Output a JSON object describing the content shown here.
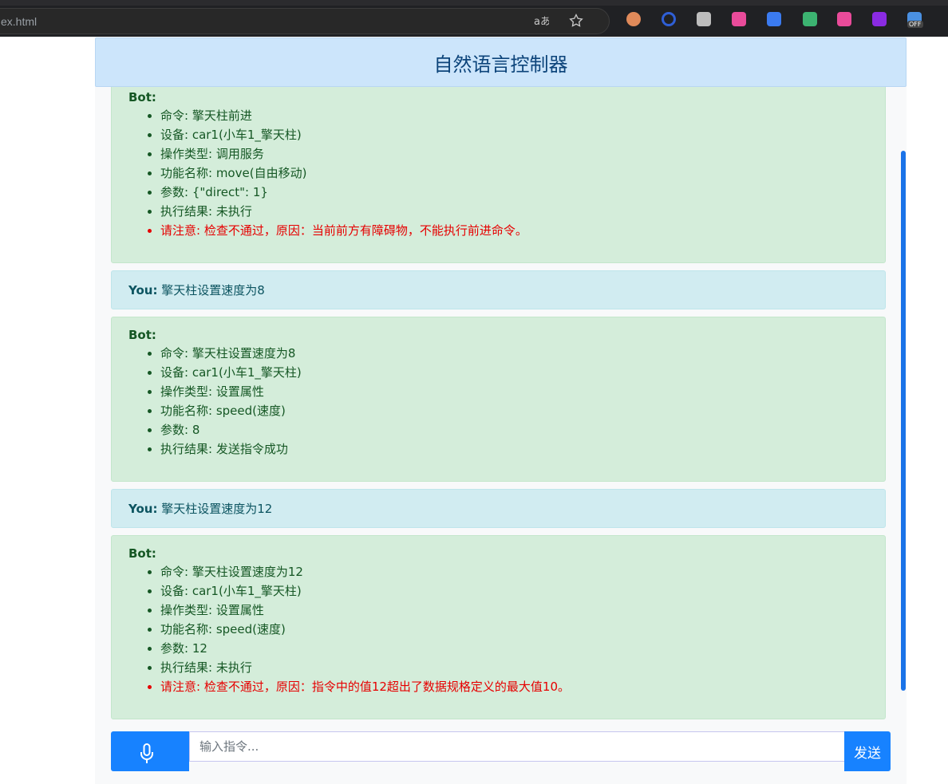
{
  "browser": {
    "url": "ex.html",
    "translate_icon": "translate-icon",
    "bookmark_icon": "star-icon",
    "extensions": [
      {
        "name": "glasses-ext-icon",
        "color": "#e08a5a"
      },
      {
        "name": "circle-ext-icon",
        "color": "#2f5fd6"
      },
      {
        "name": "camera-ext-icon",
        "color": "#bdbdbd"
      },
      {
        "name": "pinwheel-ext-icon",
        "color": "#e94b9a"
      },
      {
        "name": "mountain-ext-icon",
        "color": "#3b7bf0"
      },
      {
        "name": "shield-ext-icon",
        "color": "#3cb371"
      },
      {
        "name": "translate-ext-icon",
        "color": "#e94b9a"
      },
      {
        "name": "play-ext-icon",
        "color": "#8a2be2"
      },
      {
        "name": "toggle-ext-icon",
        "color": "#4a90e2",
        "badge": "OFF"
      }
    ]
  },
  "app": {
    "title": "自然语言控制器",
    "messages": [
      {
        "role": "bot",
        "label": "Bot:",
        "items": [
          {
            "text": "命令: 擎天柱前进"
          },
          {
            "text": "设备: car1(小车1_擎天柱)"
          },
          {
            "text": "操作类型: 调用服务"
          },
          {
            "text": "功能名称: move(自由移动)"
          },
          {
            "text": "参数: {\"direct\": 1}"
          },
          {
            "text": "执行结果: 未执行"
          },
          {
            "text": "请注意: 检查不通过，原因：当前前方有障碍物，不能执行前进命令。",
            "warn": true
          }
        ]
      },
      {
        "role": "you",
        "label": "You:",
        "text": "擎天柱设置速度为8"
      },
      {
        "role": "bot",
        "label": "Bot:",
        "items": [
          {
            "text": "命令: 擎天柱设置速度为8"
          },
          {
            "text": "设备: car1(小车1_擎天柱)"
          },
          {
            "text": "操作类型: 设置属性"
          },
          {
            "text": "功能名称: speed(速度)"
          },
          {
            "text": "参数: 8"
          },
          {
            "text": "执行结果: 发送指令成功"
          }
        ]
      },
      {
        "role": "you",
        "label": "You:",
        "text": "擎天柱设置速度为12"
      },
      {
        "role": "bot",
        "label": "Bot:",
        "items": [
          {
            "text": "命令: 擎天柱设置速度为12"
          },
          {
            "text": "设备: car1(小车1_擎天柱)"
          },
          {
            "text": "操作类型: 设置属性"
          },
          {
            "text": "功能名称: speed(速度)"
          },
          {
            "text": "参数: 12"
          },
          {
            "text": "执行结果: 未执行"
          },
          {
            "text": "请注意: 检查不通过，原因：指令中的值12超出了数据规格定义的最大值10。",
            "warn": true
          }
        ]
      }
    ],
    "input": {
      "placeholder": "输入指令...",
      "value": ""
    },
    "mic_icon": "microphone-icon",
    "send_label": "发送",
    "colors": {
      "primary": "#1782ff",
      "bot_bg": "#d4edda",
      "you_bg": "#d1ecf1",
      "warn": "#e60000",
      "header_bg": "#cce5fb"
    }
  }
}
